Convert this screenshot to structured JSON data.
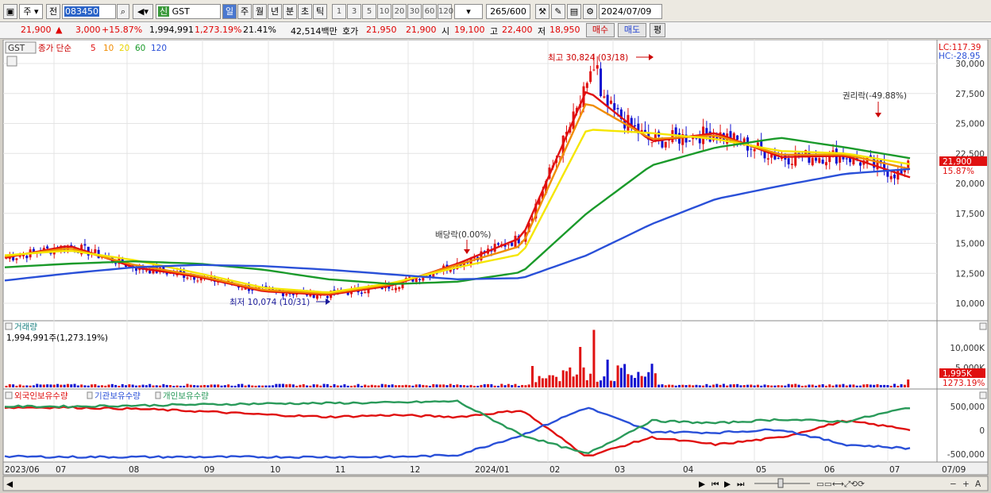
{
  "toolbar": {
    "market": "주",
    "prev": "전",
    "code": "083450",
    "credit_badge": "신",
    "name": "GST",
    "periods": [
      "일",
      "주",
      "월",
      "년",
      "분",
      "초",
      "틱"
    ],
    "active_period": "일",
    "minutes": [
      "1",
      "3",
      "5",
      "10",
      "20",
      "30",
      "60",
      "120"
    ],
    "count": "265",
    "count_total": "/600",
    "date": "2024/07/09"
  },
  "quote": {
    "price": "21,900",
    "change": "3,000",
    "change_pct": "+15.87%",
    "volume": "1,994,991",
    "volume_ratio": "1,273.19%",
    "turnover": "21.41%",
    "amount": "42,514백만",
    "bid_label": "호가",
    "ask": "21,950",
    "bid": "21,900",
    "open_label": "시",
    "open": "19,100",
    "high_label": "고",
    "high": "22,400",
    "low_label": "저",
    "low": "18,950",
    "buy_btn": "매수",
    "sell_btn": "매도",
    "eval_btn": "평"
  },
  "price_panel": {
    "tag": "GST",
    "ma_title": "종가 단순",
    "ma_periods": [
      "5",
      "10",
      "20",
      "60",
      "120"
    ],
    "lc": "LC:117.39",
    "hc": "HC:-28.95",
    "high_note": "최고 30,824 (03/18)",
    "low_note": "최저 10,074 (10/31)",
    "dividend_note": "배당락(0.00%)",
    "rights_note": "권리락(-49.88%)",
    "last_price_tag": "21,900",
    "last_pct_tag": "15.87%"
  },
  "volume_panel": {
    "title": "거래량",
    "value": "1,994,991주(1,273.19%)",
    "last_tag": "1,995K",
    "last_pct_tag": "1273.19%"
  },
  "holding_panel": {
    "titles": [
      "외국인보유수량",
      "기관보유수량",
      "개인보유수량"
    ]
  },
  "x_labels": [
    "2023/06",
    "07",
    "08",
    "09",
    "10",
    "11",
    "12",
    "2024/01",
    "02",
    "03",
    "04",
    "05",
    "06",
    "07",
    "07/09"
  ],
  "colors": {
    "up": "#e01010",
    "down": "#1010d0",
    "ma5": "#e01010",
    "ma10": "#f08c00",
    "ma20": "#f5e600",
    "ma60": "#1a9a2a",
    "ma120": "#2a50d8",
    "foreign": "#e01010",
    "institution": "#2a50d8",
    "individual": "#2a9a5a"
  },
  "chart_data": [
    {
      "type": "line",
      "name": "price",
      "x": [
        "2023/06",
        "07",
        "08",
        "09",
        "10",
        "11",
        "12",
        "2024/01",
        "02",
        "03",
        "04",
        "05",
        "06",
        "07",
        "07/09"
      ],
      "series": [
        {
          "name": "5",
          "values": [
            13800,
            14800,
            13000,
            12200,
            11000,
            10700,
            11500,
            13300,
            15500,
            27800,
            23500,
            24200,
            22200,
            22300,
            20500
          ]
        },
        {
          "name": "10",
          "values": [
            13900,
            14600,
            13200,
            12300,
            11100,
            10800,
            11600,
            13200,
            14800,
            26800,
            23700,
            24000,
            22400,
            22400,
            21200
          ]
        },
        {
          "name": "20",
          "values": [
            14000,
            14400,
            13600,
            12500,
            11300,
            10900,
            11700,
            13000,
            14100,
            24500,
            24200,
            23700,
            22700,
            22500,
            21600
          ]
        },
        {
          "name": "60",
          "values": [
            13000,
            13300,
            13500,
            13300,
            12800,
            12000,
            11600,
            11800,
            12600,
            17500,
            21500,
            23000,
            23800,
            23000,
            22100
          ]
        },
        {
          "name": "120",
          "values": [
            11900,
            12500,
            13000,
            13200,
            13100,
            12800,
            12400,
            12000,
            12100,
            14000,
            16600,
            18700,
            19800,
            20800,
            21200
          ]
        }
      ],
      "yticks": [
        10000,
        12500,
        15000,
        17500,
        20000,
        22500,
        25000,
        27500,
        30000
      ],
      "ylim": [
        9000,
        31500
      ],
      "max_point": {
        "date": "03/18",
        "value": 30824
      },
      "min_point": {
        "date": "10/31",
        "value": 10074
      },
      "last": 21900
    },
    {
      "type": "bar",
      "name": "volume",
      "yticks_label": [
        "10,000K",
        "5,000K"
      ],
      "yticks": [
        10000,
        5000
      ],
      "unit": "K",
      "last": 1995
    },
    {
      "type": "line",
      "name": "holdings",
      "yticks": [
        500000,
        0,
        -500000
      ],
      "series": [
        {
          "name": "외국인보유수량",
          "values": [
            480000,
            480000,
            450000,
            400000,
            330000,
            280000,
            320000,
            280000,
            420000,
            -550000,
            -150000,
            -300000,
            -150000,
            200000,
            20000
          ]
        },
        {
          "name": "기관보유수량",
          "values": [
            -550000,
            -560000,
            -560000,
            -560000,
            -560000,
            -560000,
            -560000,
            -520000,
            -100000,
            480000,
            -30000,
            -50000,
            20000,
            -300000,
            -380000
          ]
        },
        {
          "name": "개인보유수량",
          "values": [
            500000,
            500000,
            520000,
            540000,
            560000,
            570000,
            580000,
            610000,
            -100000,
            -500000,
            200000,
            150000,
            230000,
            180000,
            480000
          ]
        }
      ]
    }
  ]
}
